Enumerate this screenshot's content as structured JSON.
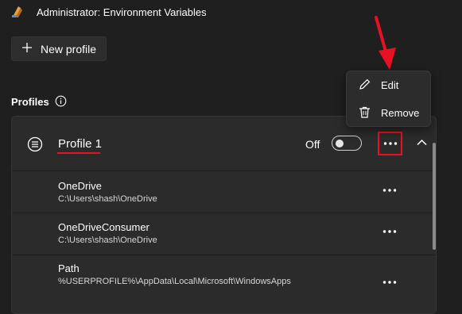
{
  "window": {
    "title": "Administrator: Environment Variables"
  },
  "toolbar": {
    "new_profile_label": "New profile"
  },
  "profiles_section": {
    "title": "Profiles"
  },
  "profile": {
    "name": "Profile 1",
    "toggle_label": "Off",
    "variables": [
      {
        "name": "OneDrive",
        "value": "C:\\Users\\shash\\OneDrive"
      },
      {
        "name": "OneDriveConsumer",
        "value": "C:\\Users\\shash\\OneDrive"
      },
      {
        "name": "Path",
        "value": "%USERPROFILE%\\AppData\\Local\\Microsoft\\WindowsApps"
      }
    ]
  },
  "context_menu": {
    "edit_label": "Edit",
    "remove_label": "Remove"
  },
  "colors": {
    "background": "#1f1f1f",
    "panel": "#2b2b2b",
    "highlight": "#e81123",
    "accent_icon": "#e9a13a"
  },
  "icons": [
    "app-icon",
    "plus-icon",
    "info-icon",
    "list-icon",
    "more-icon",
    "chevron-up-icon",
    "pencil-icon",
    "trash-icon",
    "arrow-annotation"
  ]
}
